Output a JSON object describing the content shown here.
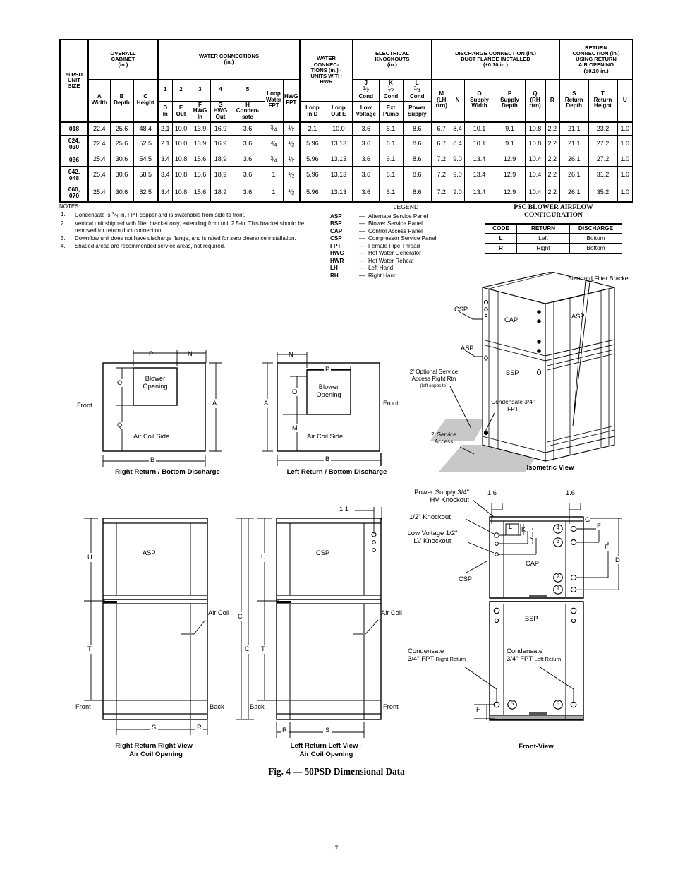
{
  "table": {
    "groups": {
      "unit_size": "50PSD\nUNIT\nSIZE",
      "unit_size_l1": "50PSD",
      "unit_size_l2": "UNIT",
      "unit_size_l3": "SIZE",
      "overall_cabinet": "OVERALL\nCABINET\n(in.)",
      "overall_cabinet_l1": "OVERALL",
      "overall_cabinet_l2": "CABINET",
      "overall_cabinet_l3": "(in.)",
      "water_connections": "WATER CONNECTIONS",
      "water_connections_unit": "(in.)",
      "water_conn_hwr_l1": "WATER",
      "water_conn_hwr_l2": "CONNEC-",
      "water_conn_hwr_l3": "TIONS (in.) -",
      "water_conn_hwr_l4": "UNITS WITH",
      "water_conn_hwr_l5": "HWR",
      "electrical_l1": "ELECTRICAL",
      "electrical_l2": "KNOCKOUTS",
      "electrical_l3": "(in.)",
      "discharge_l1": "DISCHARGE CONNECTION (in.)",
      "discharge_l2": "DUCT FLANGE INSTALLED",
      "discharge_l3": "(±0.10 in.)",
      "return_l1": "RETURN",
      "return_l2": "CONNECTION (in.)",
      "return_l3": "USING RETURN",
      "return_l4": "AIR OPENING",
      "return_l5": "(±0.10 in.)"
    },
    "numbered": {
      "n1": "1",
      "n2": "2",
      "n3": "3",
      "n4": "4",
      "n5": "5",
      "h1": "1",
      "h2": "2"
    },
    "midlabels": {
      "loop_water_fpt_l1": "Loop",
      "loop_water_fpt_l2": "Water",
      "loop_water_fpt_l3": "FPT",
      "hwg_fpt_l1": "HWG",
      "hwg_fpt_l2": "FPT",
      "J_l1": "J",
      "J_frac": "1/2",
      "J_l3": "Cond",
      "K_l1": "K",
      "K_frac": "1/2",
      "K_l3": "Cond",
      "L_l1": "L",
      "L_frac": "3/4",
      "L_l3": "Cond",
      "M_l1": "M",
      "M_l2": "(LH",
      "M_l3": "rtrn)",
      "N_l1": "N",
      "O_l1": "O",
      "O_l2": "Supply",
      "O_l3": "Width",
      "P_l1": "P",
      "P_l2": "Supply",
      "P_l3": "Depth",
      "Q_l1": "Q",
      "Q_l2": "(RH",
      "Q_l3": "rtrn)",
      "R_l1": "R",
      "S_l1": "S",
      "S_l2": "Return",
      "S_l3": "Depth",
      "T_l1": "T",
      "T_l2": "Return",
      "T_l3": "Height",
      "U_l1": "U"
    },
    "sub": {
      "A_l1": "A",
      "A_l2": "Width",
      "B_l1": "B",
      "B_l2": "Depth",
      "C_l1": "C",
      "C_l2": "Height",
      "D_l1": "D",
      "D_l2": "In",
      "E_l1": "E",
      "E_l2": "Out",
      "F_l1": "F",
      "F_l2": "HWG",
      "F_l3": "In",
      "G_l1": "G",
      "G_l2": "HWG",
      "G_l3": "Out",
      "H_l1": "H",
      "H_l2": "Conden-",
      "H_l3": "sate",
      "loopInD_l1": "Loop",
      "loopInD_l2": "In D",
      "loopOutE_l1": "Loop",
      "loopOutE_l2": "Out E",
      "lowVolt_l1": "Low",
      "lowVolt_l2": "Voltage",
      "extPump_l1": "Ext",
      "extPump_l2": "Pump",
      "powerSup_l1": "Power",
      "powerSup_l2": "Supply"
    },
    "rows": [
      {
        "unit": "018",
        "unit_l1": "018",
        "unit_l2": "",
        "A": "22.4",
        "B": "25.6",
        "C": "48.4",
        "D": "2.1",
        "E": "10.0",
        "F": "13.9",
        "G": "16.9",
        "H": "3.6",
        "loopWaterFPT": "3/4",
        "hwgFPT": "1/2",
        "hwr1": "2.1",
        "hwr2": "10.0",
        "J": "3.6",
        "K": "6.1",
        "L": "8.6",
        "M": "6.7",
        "N": "8.4",
        "O": "10.1",
        "P": "9.1",
        "Q": "10.8",
        "R": "2.2",
        "S": "21.1",
        "T": "23.2",
        "U": "1.0"
      },
      {
        "unit": "024, 030",
        "unit_l1": "024,",
        "unit_l2": "030",
        "A": "22.4",
        "B": "25.6",
        "C": "52.5",
        "D": "2.1",
        "E": "10.0",
        "F": "13.9",
        "G": "16.9",
        "H": "3.6",
        "loopWaterFPT": "3/4",
        "hwgFPT": "1/2",
        "hwr1": "5.96",
        "hwr2": "13.13",
        "J": "3.6",
        "K": "6.1",
        "L": "8.6",
        "M": "6.7",
        "N": "8.4",
        "O": "10.1",
        "P": "9.1",
        "Q": "10.8",
        "R": "2.2",
        "S": "21.1",
        "T": "27.2",
        "U": "1.0"
      },
      {
        "unit": "036",
        "unit_l1": "036",
        "unit_l2": "",
        "A": "25.4",
        "B": "30.6",
        "C": "54.5",
        "D": "3.4",
        "E": "10.8",
        "F": "15.6",
        "G": "18.9",
        "H": "3.6",
        "loopWaterFPT": "3/4",
        "hwgFPT": "1/2",
        "hwr1": "5.96",
        "hwr2": "13.13",
        "J": "3.6",
        "K": "6.1",
        "L": "8.6",
        "M": "7.2",
        "N": "9.0",
        "O": "13.4",
        "P": "12.9",
        "Q": "10.4",
        "R": "2.2",
        "S": "26.1",
        "T": "27.2",
        "U": "1.0"
      },
      {
        "unit": "042, 048",
        "unit_l1": "042,",
        "unit_l2": "048",
        "A": "25.4",
        "B": "30.6",
        "C": "58.5",
        "D": "3.4",
        "E": "10.8",
        "F": "15.6",
        "G": "18.9",
        "H": "3.6",
        "loopWaterFPT": "1",
        "hwgFPT": "1/2",
        "hwr1": "5.96",
        "hwr2": "13.13",
        "J": "3.6",
        "K": "6.1",
        "L": "8.6",
        "M": "7.2",
        "N": "9.0",
        "O": "13.4",
        "P": "12.9",
        "Q": "10.4",
        "R": "2.2",
        "S": "26.1",
        "T": "31.2",
        "U": "1.0"
      },
      {
        "unit": "060, 070",
        "unit_l1": "060,",
        "unit_l2": "070",
        "A": "25.4",
        "B": "30.6",
        "C": "62.5",
        "D": "3.4",
        "E": "10.8",
        "F": "15.6",
        "G": "18.9",
        "H": "3.6",
        "loopWaterFPT": "1",
        "hwgFPT": "1/2",
        "hwr1": "5.96",
        "hwr2": "13.13",
        "J": "3.6",
        "K": "6.1",
        "L": "8.6",
        "M": "7.2",
        "N": "9.0",
        "O": "13.4",
        "P": "12.9",
        "Q": "10.4",
        "R": "2.2",
        "S": "26.1",
        "T": "35.2",
        "U": "1.0"
      }
    ]
  },
  "notes": {
    "title": "NOTES:",
    "items": [
      {
        "num": "1.",
        "text": "Condensate is 3/4-in. FPT copper and is switchable from side to front."
      },
      {
        "num": "2.",
        "text": "Vertical unit shipped with filter bracket only, extending from unit 2.5-in. This bracket should be removed for return duct connection."
      },
      {
        "num": "3.",
        "text": "Downflow unit does not have discharge flange, and is rated for zero clearance installation."
      },
      {
        "num": "4.",
        "text": "Shaded areas are recommended service areas, not required."
      }
    ]
  },
  "legend": {
    "title": "LEGEND",
    "items": [
      {
        "abbr": "ASP",
        "dash": "—",
        "text": "Alternate Service Panel"
      },
      {
        "abbr": "BSP",
        "dash": "—",
        "text": "Blower Service Panel"
      },
      {
        "abbr": "CAP",
        "dash": "—",
        "text": "Control Access Panel"
      },
      {
        "abbr": "CSP",
        "dash": "—",
        "text": "Compressor Service Panel"
      },
      {
        "abbr": "FPT",
        "dash": "—",
        "text": "Female Pipe Thread"
      },
      {
        "abbr": "HWG",
        "dash": "—",
        "text": "Hot Water Generator"
      },
      {
        "abbr": "HWR",
        "dash": "—",
        "text": "Hot Water Reheat"
      },
      {
        "abbr": "LH",
        "dash": "—",
        "text": "Left Hand"
      },
      {
        "abbr": "RH",
        "dash": "—",
        "text": "Right Hand"
      }
    ]
  },
  "psc": {
    "title_l1": "PSC BLOWER AIRFLOW",
    "title_l2": "CONFIGURATION",
    "headers": {
      "code": "CODE",
      "return": "RETURN",
      "discharge": "DISCHARGE"
    },
    "rows": [
      {
        "code": "L",
        "return": "Left",
        "discharge": "Bottom"
      },
      {
        "code": "R",
        "return": "Right",
        "discharge": "Bottom"
      }
    ]
  },
  "diagrams": {
    "right_return_plan": {
      "caption_l1": "Right Return / Bottom Discharge",
      "blower_l1": "Blower",
      "blower_l2": "Opening",
      "front": "Front",
      "air_coil_side": "Air Coil Side",
      "dim_P": "P",
      "dim_N": "N",
      "dim_O": "O",
      "dim_Q": "Q",
      "dim_A": "A",
      "dim_B": "B"
    },
    "left_return_plan": {
      "caption_l1": "Left Return / Bottom Discharge",
      "blower_l1": "Blower",
      "blower_l2": "Opening",
      "front": "Front",
      "air_coil_side": "Air Coil Side",
      "dim_P": "P",
      "dim_N": "N",
      "dim_O": "O",
      "dim_M": "M",
      "dim_A": "A",
      "dim_B": "B"
    },
    "isometric": {
      "caption": "Isometric View",
      "filter_bracket": "Standard Filter Bracket",
      "csp": "CSP",
      "asp_left": "ASP",
      "cap": "CAP",
      "asp_face": "ASP",
      "bsp": "BSP",
      "opt_service_l1": "2'  Optional Service",
      "opt_service_l2": "Access Right Rtn",
      "opt_service_l3": "(left opposite)",
      "service_l1": "2'  Service",
      "service_l2": "Access",
      "condensate_l1": "Condensate 3/4\"",
      "condensate_l2": "FPT"
    },
    "right_view": {
      "caption_l1": "Right Return Right View -",
      "caption_l2": "Air Coil Opening",
      "asp": "ASP",
      "air_coil": "Air Coil",
      "front": "Front",
      "back": "Back",
      "dim_U": "U",
      "dim_T": "T",
      "dim_C": "C",
      "dim_S": "S",
      "dim_R": "R"
    },
    "left_view": {
      "caption_l1": "Left Return Left View -",
      "caption_l2": "Air Coil Opening",
      "csp": "CSP",
      "air_coil": "Air Coil",
      "front": "Front",
      "back": "Back",
      "dim_U": "U",
      "dim_T": "T",
      "dim_C": "C",
      "dim_S": "S",
      "dim_R": "R",
      "dim_1_1": "1.1"
    },
    "front_view": {
      "caption": "Front-View",
      "power_supply_l1": "Power Supply 3/4\"",
      "power_supply_l2": "HV Knockout",
      "half_knockout": "1/2\" Knockout",
      "low_voltage_l1": "Low Voltage 1/2\"",
      "low_voltage_l2": "LV Knockout",
      "csp": "CSP",
      "cap": "CAP",
      "bsp": "BSP",
      "cond_right_l1": "Condensate",
      "cond_right_l2": "3/4\" FPT",
      "cond_right_l3": "Right Return",
      "cond_left_l1": "Condensate",
      "cond_left_l2": "3/4\" FPT",
      "cond_left_l3": "Left Return",
      "dim_1_6a": "1.6",
      "dim_1_6b": "1.6",
      "lbl_L": "L",
      "lbl_K": "K",
      "lbl_J": "J",
      "lbl_G": "G",
      "lbl_F": "F",
      "lbl_E": "E",
      "lbl_D": "D",
      "lbl_H": "H",
      "callout_1": "1",
      "callout_2": "2",
      "callout_3": "3",
      "callout_4": "4",
      "callout_5a": "5",
      "callout_5b": "5"
    }
  },
  "figure_caption": "Fig. 4 — 50PSD Dimensional Data",
  "page_number": "7"
}
